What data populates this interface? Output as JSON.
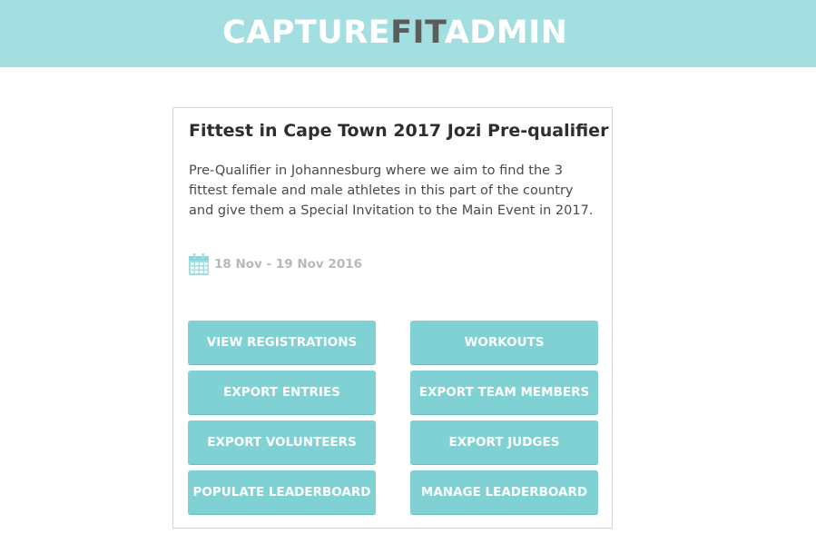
{
  "header": {
    "brand_part1": "CAPTURE",
    "brand_part2": "FIT",
    "brand_part3": "ADMIN",
    "background_color": "#a3dfe0"
  },
  "event": {
    "title": "Fittest in Cape Town 2017 Jozi Pre-qualifier",
    "description": "Pre-Qualifier in Johannesburg where we aim to find the 3 fittest female and male athletes in this part of the country and give them a Special Invitation to the Main Event in 2017.",
    "date_icon": "calendar-icon",
    "date_range": "18 Nov - 19 Nov 2016"
  },
  "actions": {
    "button_color": "#7fd1d3",
    "view_registrations": "VIEW REGISTRATIONS",
    "workouts": "WORKOUTS",
    "export_entries": "EXPORT ENTRIES",
    "export_team_members": "EXPORT TEAM MEMBERS",
    "export_volunteers": "EXPORT VOLUNTEERS",
    "export_judges": "EXPORT JUDGES",
    "populate_leaderboard": "POPULATE LEADERBOARD",
    "manage_leaderboard": "MANAGE LEADERBOARD"
  }
}
